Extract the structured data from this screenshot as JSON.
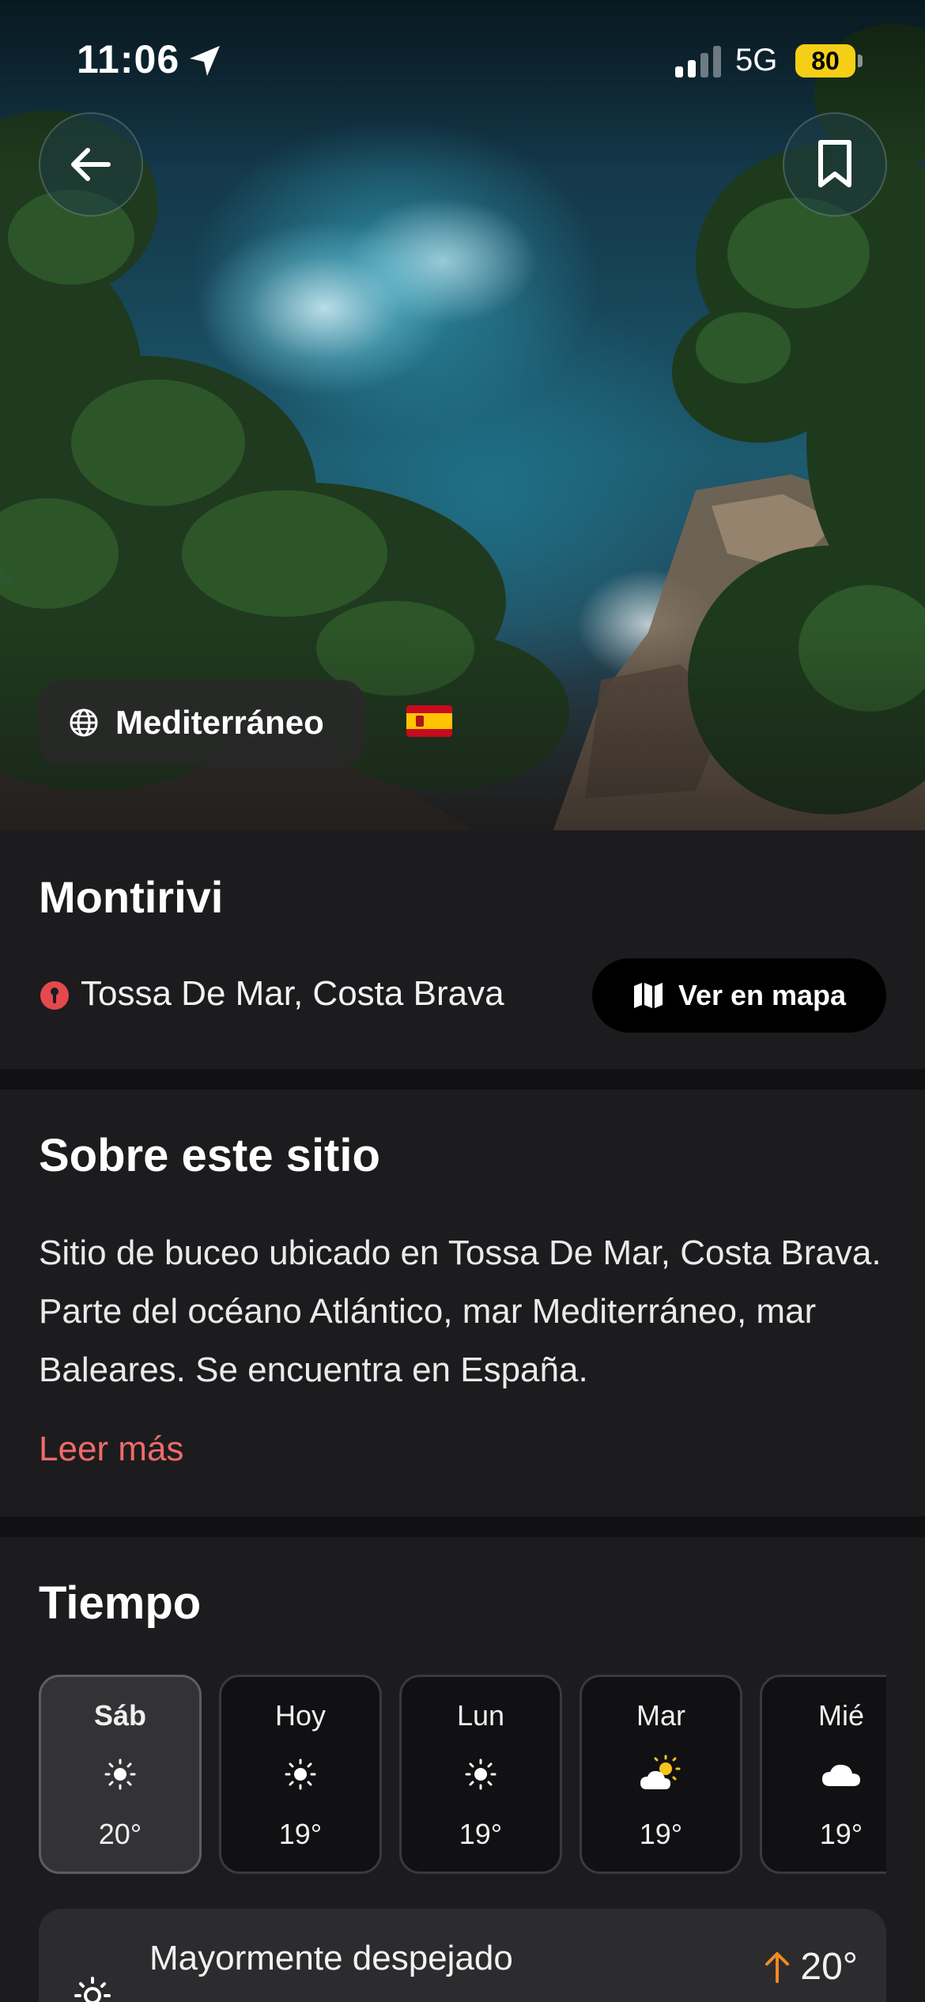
{
  "status_bar": {
    "time": "11:06",
    "network": "5G",
    "battery": "80",
    "icons": [
      "location-arrow-icon",
      "signal-icon",
      "battery-icon"
    ]
  },
  "hero": {
    "region": "Mediterráneo",
    "country_flag": "Spain",
    "icons": [
      "back-arrow-icon",
      "bookmark-icon",
      "globe-icon"
    ]
  },
  "site": {
    "title": "Montirivi",
    "location": "Tossa De Mar, Costa Brava",
    "map_button": "Ver en mapa",
    "icons": [
      "pin-icon",
      "map-icon"
    ]
  },
  "about": {
    "heading": "Sobre este sitio",
    "description": "Sitio de buceo ubicado en Tossa De Mar, Costa Brava. Parte del océano Atlántico, mar Mediterráneo, mar Baleares. Se encuentra en España.",
    "read_more": "Leer más"
  },
  "weather": {
    "heading": "Tiempo",
    "days": [
      {
        "name": "Sáb",
        "temp": "20°",
        "icon": "sun-icon",
        "selected": true
      },
      {
        "name": "Hoy",
        "temp": "19°",
        "icon": "sun-icon",
        "selected": false
      },
      {
        "name": "Lun",
        "temp": "19°",
        "icon": "sun-icon",
        "selected": false
      },
      {
        "name": "Mar",
        "temp": "19°",
        "icon": "partly-cloudy-icon",
        "selected": false
      },
      {
        "name": "Mié",
        "temp": "19°",
        "icon": "cloud-icon",
        "selected": false
      }
    ],
    "summary": {
      "text": "Mayormente despejado",
      "high": "20°",
      "icon": "sun-icon"
    }
  },
  "colors": {
    "background": "#1c1c1e",
    "accent": "#f06a6a",
    "battery": "#f5cf16",
    "high_arrow": "#f08a24"
  }
}
